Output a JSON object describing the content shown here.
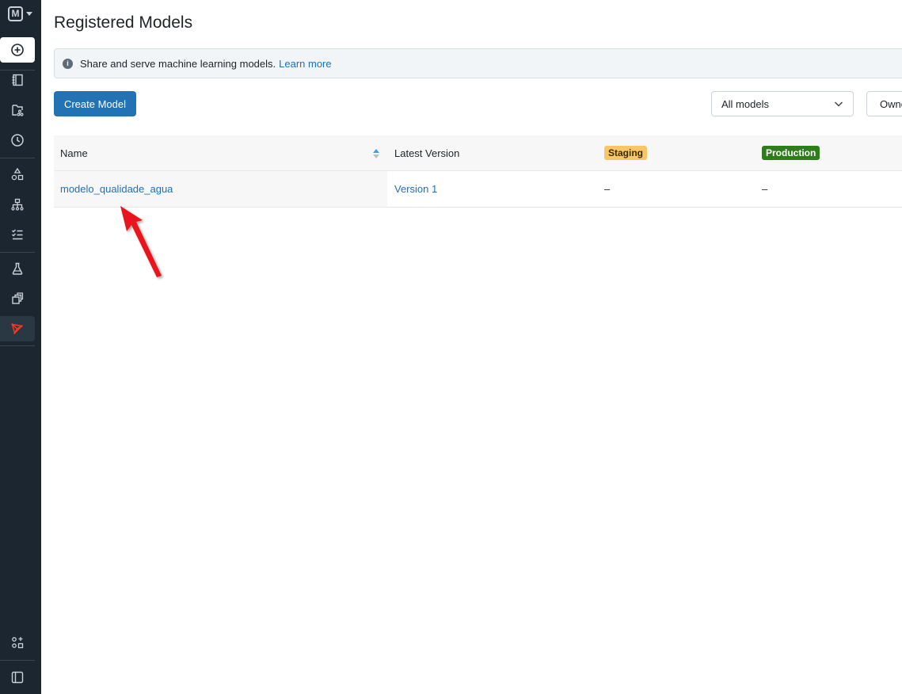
{
  "sidebar": {
    "logo_letter": "M",
    "items": [
      {
        "name": "new",
        "icon": "plus-circle-icon"
      },
      {
        "name": "notebooks",
        "icon": "notebook-icon"
      },
      {
        "name": "repos",
        "icon": "folder-git-icon"
      },
      {
        "name": "recents",
        "icon": "clock-icon"
      },
      {
        "name": "catalog",
        "icon": "shapes-icon"
      },
      {
        "name": "workflows",
        "icon": "workflow-icon"
      },
      {
        "name": "tasks",
        "icon": "checklist-icon"
      },
      {
        "name": "experiments",
        "icon": "flask-icon"
      },
      {
        "name": "features",
        "icon": "stack-icon"
      },
      {
        "name": "models",
        "icon": "models-icon",
        "active": true
      },
      {
        "name": "marketplace",
        "icon": "partner-icon"
      },
      {
        "name": "collapse",
        "icon": "sidebar-toggle-icon"
      }
    ]
  },
  "page": {
    "title": "Registered Models",
    "banner_text": "Share and serve machine learning models.",
    "banner_link": "Learn more",
    "create_button": "Create Model",
    "filter_select": "All models",
    "owner_button": "Owner"
  },
  "table": {
    "headers": {
      "name": "Name",
      "latest_version": "Latest Version",
      "staging": "Staging",
      "production": "Production"
    },
    "rows": [
      {
        "name": "modelo_qualidade_agua",
        "latest_version": "Version 1",
        "staging": "–",
        "production": "–"
      }
    ]
  },
  "colors": {
    "sidebar_bg": "#1b2630",
    "primary": "#2272b4",
    "link": "#2270b8",
    "staging_tag": "#f7c766",
    "production_tag": "#2e7d1a",
    "annotation_arrow": "#e8141c"
  }
}
